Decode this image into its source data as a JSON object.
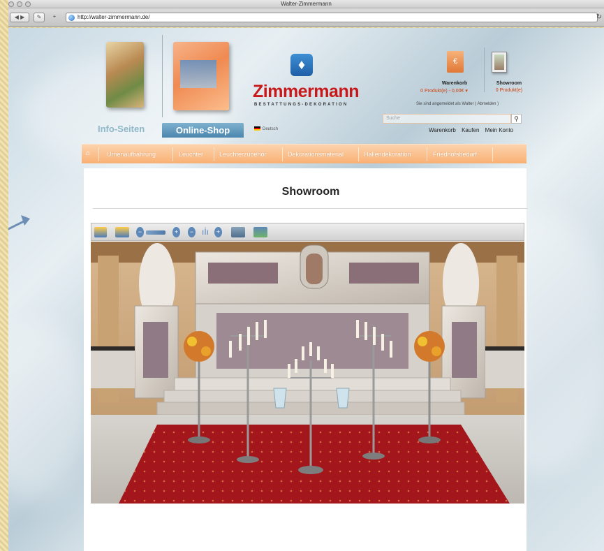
{
  "browser": {
    "window_title": "Walter-Zimmermann",
    "url": "http://walter-zimmermann.de/",
    "back_icon": "back-arrow-icon",
    "forward_icon": "forward-arrow-icon",
    "reload_icon": "reload-icon"
  },
  "header": {
    "logo_text": "Zimmermann",
    "logo_subtitle": "BESTATTUNGS-DEKORATION",
    "tabs": [
      "Info-Seiten",
      "Online-Shop"
    ],
    "language": "Deutsch",
    "cart": {
      "label": "Warenkorb",
      "value": "0 Produkt(e) - 0,00€ ▾"
    },
    "showroom": {
      "label": "Showroom",
      "value": "0 Produkt(e)"
    },
    "logged_in": "Sie sind angemeldet als Walter ( Abmelden )",
    "search_placeholder": "Suche",
    "quick_links": [
      "Warenkorb",
      "Kaufen",
      "Mein Konto"
    ]
  },
  "nav": {
    "items": [
      "Urnenaufbahrung",
      "Leuchter",
      "Leuchterzubehör",
      "Dekorationsmaterial",
      "Hallendekoration",
      "Friedhofsbedarf"
    ]
  },
  "main": {
    "title": "Showroom"
  },
  "toolbar_icons": [
    "change-background-icon",
    "remove-background-icon",
    "zoom-out-icon",
    "size-icon",
    "zoom-in-icon",
    "height-decrease-icon",
    "candles-icon",
    "height-increase-icon",
    "print-icon",
    "save-icon"
  ],
  "colors": {
    "brand_red": "#c8191a",
    "nav_orange": "#f9b073",
    "price_orange": "#d04010",
    "tab_blue": "#4b86ad"
  }
}
